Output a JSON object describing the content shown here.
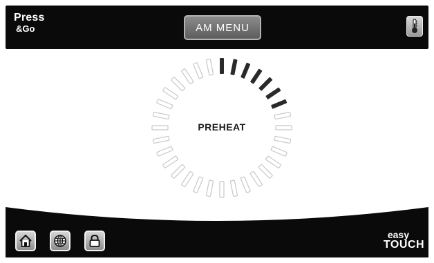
{
  "header": {
    "brand_line1": "Press",
    "brand_line2": "&Go",
    "menu_button_label": "AM MENU",
    "settings_icon": "thermometer-icon"
  },
  "main": {
    "status_label": "PREHEAT",
    "progress": {
      "segments_total": 32,
      "segments_filled": 7
    }
  },
  "footer": {
    "buttons": [
      {
        "icon": "home-icon"
      },
      {
        "icon": "globe-icon"
      },
      {
        "icon": "lock-icon"
      }
    ],
    "logo_line1": "easy",
    "logo_line2": "TOUCH"
  },
  "colors": {
    "bar_background": "#0a0a0a",
    "segment_filled": "#2a2a2a",
    "segment_empty_stroke": "#c8c8c8",
    "button_face": "#a0a0a0"
  }
}
